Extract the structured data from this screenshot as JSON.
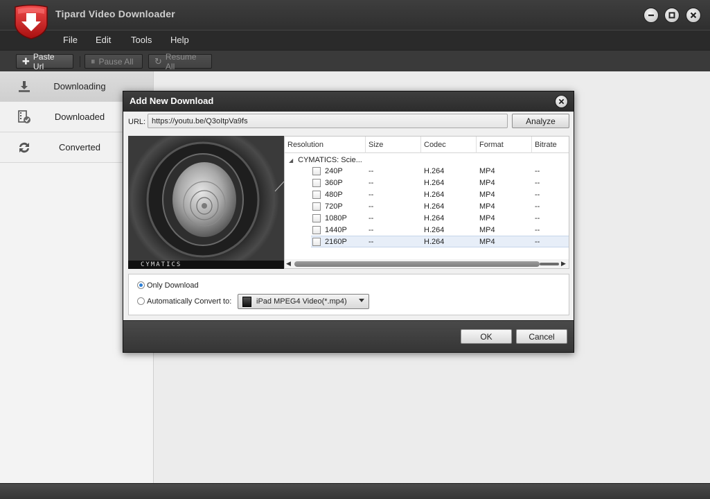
{
  "app": {
    "title": "Tipard Video Downloader"
  },
  "menu": [
    "File",
    "Edit",
    "Tools",
    "Help"
  ],
  "toolbar": {
    "paste_url": "Paste Url",
    "pause_all": "Pause All",
    "resume_all": "Resume All"
  },
  "sidebar": {
    "items": [
      {
        "label": "Downloading",
        "icon": "download-icon",
        "active": true
      },
      {
        "label": "Downloaded",
        "icon": "film-check-icon",
        "active": false
      },
      {
        "label": "Converted",
        "icon": "convert-icon",
        "active": false
      }
    ]
  },
  "dialog": {
    "title": "Add New Download",
    "url_label": "URL:",
    "url_value": "https://youtu.be/Q3oItpVa9fs",
    "analyze": "Analyze",
    "preview_caption": "CYMATICS",
    "table": {
      "columns": [
        "Resolution",
        "Size",
        "Codec",
        "Format",
        "Bitrate"
      ],
      "root": "CYMATICS: Scie...",
      "rows": [
        {
          "resolution": "240P",
          "size": "--",
          "codec": "H.264",
          "format": "MP4",
          "bitrate": "--",
          "selected": false
        },
        {
          "resolution": "360P",
          "size": "--",
          "codec": "H.264",
          "format": "MP4",
          "bitrate": "--",
          "selected": false
        },
        {
          "resolution": "480P",
          "size": "--",
          "codec": "H.264",
          "format": "MP4",
          "bitrate": "--",
          "selected": false
        },
        {
          "resolution": "720P",
          "size": "--",
          "codec": "H.264",
          "format": "MP4",
          "bitrate": "--",
          "selected": false
        },
        {
          "resolution": "1080P",
          "size": "--",
          "codec": "H.264",
          "format": "MP4",
          "bitrate": "--",
          "selected": false
        },
        {
          "resolution": "1440P",
          "size": "--",
          "codec": "H.264",
          "format": "MP4",
          "bitrate": "--",
          "selected": false
        },
        {
          "resolution": "2160P",
          "size": "--",
          "codec": "H.264",
          "format": "MP4",
          "bitrate": "--",
          "selected": true
        }
      ]
    },
    "options": {
      "only_download": "Only Download",
      "auto_convert": "Automatically Convert to:",
      "convert_format": "iPad MPEG4 Video(*.mp4)",
      "selected": "only_download"
    },
    "ok": "OK",
    "cancel": "Cancel"
  },
  "colors": {
    "chrome_dark": "#2f2f2f",
    "logo_red": "#d42121",
    "selection": "#e7eef8",
    "radio_accent": "#2d7fd6"
  }
}
